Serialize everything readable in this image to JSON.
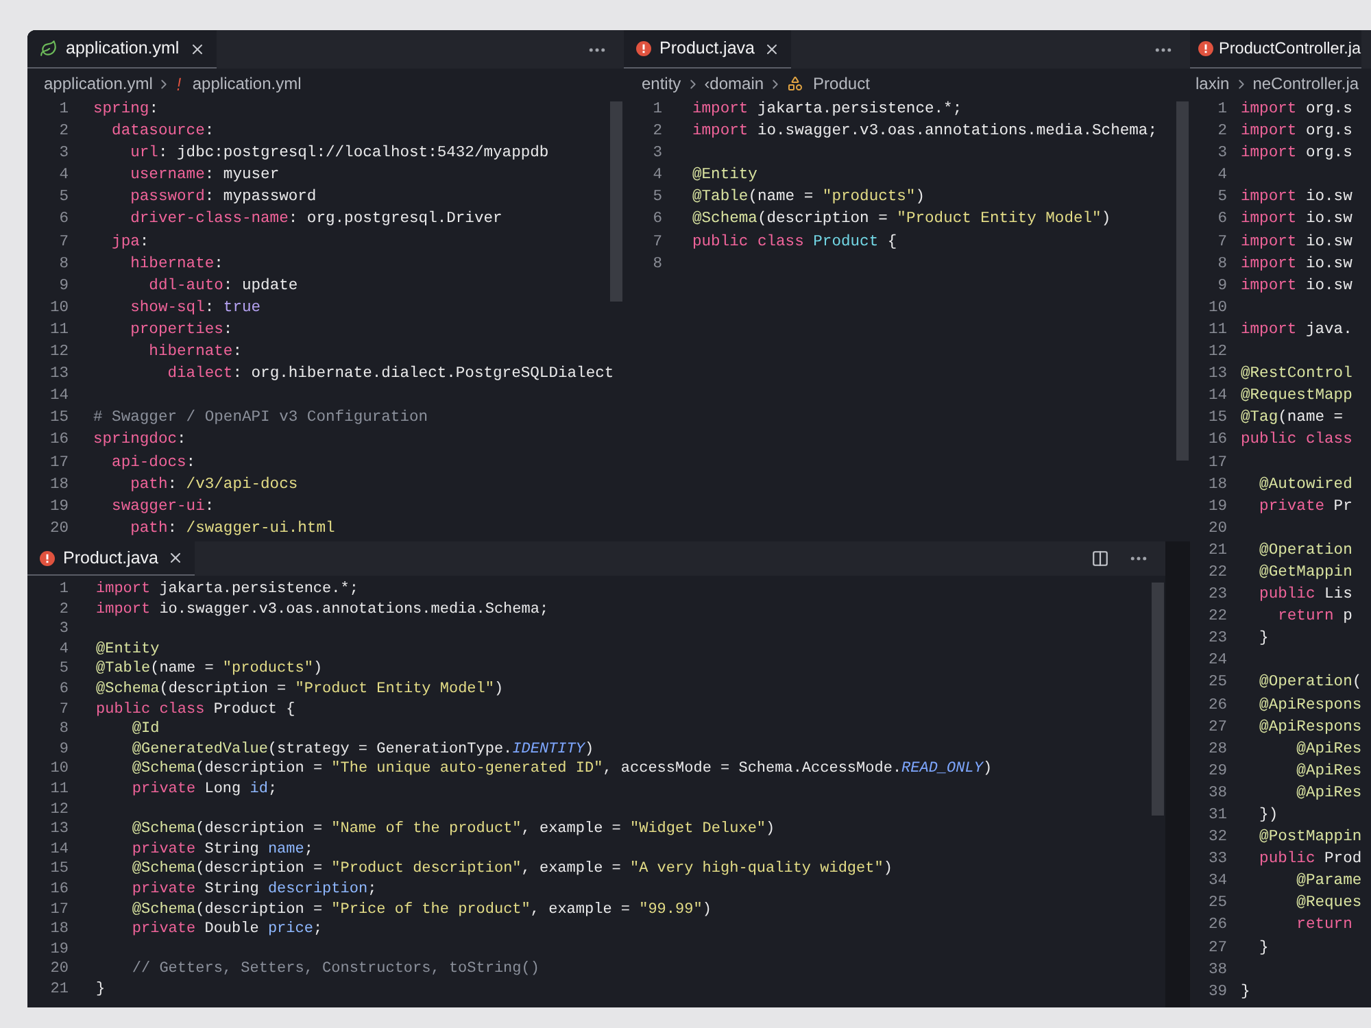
{
  "main": {
    "top_editors": [
      {
        "tab": {
          "label": "application.yml",
          "kind": "yaml",
          "selected": true
        },
        "breadcrumb": [
          {
            "label": "application.yml",
            "kind": "path"
          },
          {
            "label": "application.yml",
            "kind": "file"
          }
        ],
        "actions": [
          {
            "kind": "more"
          }
        ],
        "lines": [
          {
            "number": "1",
            "tokens": [
              {
                "kind": "key",
                "text": "spring"
              },
              {
                "kind": "plain",
                "text": ":"
              }
            ]
          },
          {
            "number": "2",
            "tokens": [
              {
                "kind": "key",
                "text": "  datasource"
              },
              {
                "kind": "plain",
                "text": ":"
              }
            ]
          },
          {
            "number": "3",
            "tokens": [
              {
                "kind": "key",
                "text": "    url"
              },
              {
                "kind": "plain",
                "text": ": jdbc:postgresql://localhost:5432/myappdb"
              }
            ]
          },
          {
            "number": "4",
            "tokens": [
              {
                "kind": "key",
                "text": "    username"
              },
              {
                "kind": "plain",
                "text": ": myuser"
              }
            ]
          },
          {
            "number": "5",
            "tokens": [
              {
                "kind": "key",
                "text": "    password"
              },
              {
                "kind": "plain",
                "text": ": mypassword"
              }
            ]
          },
          {
            "number": "6",
            "tokens": [
              {
                "kind": "key",
                "text": "    driver-class-name"
              },
              {
                "kind": "plain",
                "text": ": org.postgresql.Driver"
              }
            ]
          },
          {
            "number": "7",
            "tokens": [
              {
                "kind": "key",
                "text": "  jpa"
              },
              {
                "kind": "plain",
                "text": ":"
              }
            ]
          },
          {
            "number": "8",
            "tokens": [
              {
                "kind": "key",
                "text": "    hibernate"
              },
              {
                "kind": "plain",
                "text": ":"
              }
            ]
          },
          {
            "number": "9",
            "tokens": [
              {
                "kind": "key",
                "text": "      ddl-auto"
              },
              {
                "kind": "plain",
                "text": ": update"
              }
            ]
          },
          {
            "number": "10",
            "tokens": [
              {
                "kind": "key",
                "text": "    show-sql"
              },
              {
                "kind": "plain",
                "text": ": "
              },
              {
                "kind": "bool",
                "text": "true"
              }
            ]
          },
          {
            "number": "11",
            "tokens": [
              {
                "kind": "key",
                "text": "    properties"
              },
              {
                "kind": "plain",
                "text": ":"
              }
            ]
          },
          {
            "number": "12",
            "tokens": [
              {
                "kind": "key",
                "text": "      hibernate"
              },
              {
                "kind": "plain",
                "text": ":"
              }
            ]
          },
          {
            "number": "13",
            "tokens": [
              {
                "kind": "key",
                "text": "        dialect"
              },
              {
                "kind": "plain",
                "text": ": org.hibernate.dialect.PostgreSQLDialect"
              }
            ]
          },
          {
            "number": "14"
          },
          {
            "number": "15",
            "tokens": [
              {
                "kind": "comment",
                "text": "# Swagger / OpenAPI v3 Configuration"
              }
            ]
          },
          {
            "number": "16",
            "tokens": [
              {
                "kind": "key",
                "text": "springdoc"
              },
              {
                "kind": "plain",
                "text": ":"
              }
            ]
          },
          {
            "number": "17",
            "tokens": [
              {
                "kind": "key",
                "text": "  api-docs"
              },
              {
                "kind": "plain",
                "text": ":"
              }
            ]
          },
          {
            "number": "18",
            "tokens": [
              {
                "kind": "key",
                "text": "    path"
              },
              {
                "kind": "plain",
                "text": ": "
              },
              {
                "kind": "str",
                "text": "/v3/api-docs"
              }
            ]
          },
          {
            "number": "19",
            "tokens": [
              {
                "kind": "key",
                "text": "  swagger-ui"
              },
              {
                "kind": "plain",
                "text": ":"
              }
            ]
          },
          {
            "number": "20",
            "tokens": [
              {
                "kind": "key",
                "text": "    path"
              },
              {
                "kind": "plain",
                "text": ": "
              },
              {
                "kind": "str",
                "text": "/swagger-ui.html"
              }
            ]
          }
        ]
      },
      {
        "tab": {
          "label": "Product.java",
          "kind": "java",
          "selected": true
        },
        "breadcrumb": [
          {
            "label": "entity",
            "kind": "path"
          },
          {
            "label": "‹domain",
            "kind": "path"
          },
          {
            "label": "Product",
            "kind": "symbol"
          }
        ],
        "actions": [
          {
            "kind": "more"
          }
        ],
        "lines": [
          {
            "number": "1",
            "tokens": [
              {
                "kind": "kw",
                "text": "import"
              },
              {
                "kind": "plain",
                "text": " jakarta.persistence.*;"
              }
            ]
          },
          {
            "number": "2",
            "tokens": [
              {
                "kind": "kw",
                "text": "import"
              },
              {
                "kind": "plain",
                "text": " io.swagger.v3.oas.annotations.media.Schema;"
              }
            ]
          },
          {
            "number": "3"
          },
          {
            "number": "4",
            "tokens": [
              {
                "kind": "ann",
                "text": "@Entity"
              }
            ]
          },
          {
            "number": "5",
            "tokens": [
              {
                "kind": "ann",
                "text": "@Table"
              },
              {
                "kind": "plain",
                "text": "(name = "
              },
              {
                "kind": "str",
                "text": "\"products\""
              },
              {
                "kind": "plain",
                "text": ")"
              }
            ]
          },
          {
            "number": "6",
            "tokens": [
              {
                "kind": "ann",
                "text": "@Schema"
              },
              {
                "kind": "plain",
                "text": "(description = "
              },
              {
                "kind": "str",
                "text": "\"Product Entity Model\""
              },
              {
                "kind": "plain",
                "text": ")"
              }
            ]
          },
          {
            "number": "7",
            "tokens": [
              {
                "kind": "kw",
                "text": "public class "
              },
              {
                "kind": "type",
                "text": "Product"
              },
              {
                "kind": "plain",
                "text": " {"
              }
            ]
          },
          {
            "number": "8"
          }
        ]
      }
    ],
    "bottom_editor": {
      "tab": {
        "label": "Product.java",
        "kind": "java",
        "selected": true
      },
      "actions": [
        {
          "kind": "split"
        },
        {
          "kind": "more"
        }
      ],
      "lines": [
        {
          "number": "1",
          "tokens": [
            {
              "kind": "kw",
              "text": "import"
            },
            {
              "kind": "plain",
              "text": " jakarta.persistence.*;"
            }
          ]
        },
        {
          "number": "2",
          "tokens": [
            {
              "kind": "kw",
              "text": "import"
            },
            {
              "kind": "plain",
              "text": " io.swagger.v3.oas.annotations.media.Schema;"
            }
          ]
        },
        {
          "number": "3"
        },
        {
          "number": "4",
          "tokens": [
            {
              "kind": "ann",
              "text": "@Entity"
            }
          ]
        },
        {
          "number": "5",
          "tokens": [
            {
              "kind": "ann",
              "text": "@Table"
            },
            {
              "kind": "plain",
              "text": "(name = "
            },
            {
              "kind": "str",
              "text": "\"products\""
            },
            {
              "kind": "plain",
              "text": ")"
            }
          ]
        },
        {
          "number": "6",
          "tokens": [
            {
              "kind": "ann",
              "text": "@Schema"
            },
            {
              "kind": "plain",
              "text": "(description = "
            },
            {
              "kind": "str",
              "text": "\"Product Entity Model\""
            },
            {
              "kind": "plain",
              "text": ")"
            }
          ]
        },
        {
          "number": "7",
          "tokens": [
            {
              "kind": "kw",
              "text": "public class"
            },
            {
              "kind": "plain",
              "text": " Product {"
            }
          ]
        },
        {
          "number": "8",
          "tokens": [
            {
              "kind": "ann",
              "text": "    @Id"
            }
          ]
        },
        {
          "number": "9",
          "tokens": [
            {
              "kind": "ann",
              "text": "    @GeneratedValue"
            },
            {
              "kind": "plain",
              "text": "(strategy = GenerationType."
            },
            {
              "kind": "const",
              "text": "IDENTITY"
            },
            {
              "kind": "plain",
              "text": ")"
            }
          ]
        },
        {
          "number": "10",
          "tokens": [
            {
              "kind": "ann",
              "text": "    @Schema"
            },
            {
              "kind": "plain",
              "text": "(description = "
            },
            {
              "kind": "str",
              "text": "\"The unique auto-generated ID\""
            },
            {
              "kind": "plain",
              "text": ", accessMode = Schema.AccessMode."
            },
            {
              "kind": "const",
              "text": "READ_ONLY"
            },
            {
              "kind": "plain",
              "text": ")"
            }
          ]
        },
        {
          "number": "11",
          "tokens": [
            {
              "kind": "kw",
              "text": "    private"
            },
            {
              "kind": "plain",
              "text": " Long "
            },
            {
              "kind": "field",
              "text": "id"
            },
            {
              "kind": "plain",
              "text": ";"
            }
          ]
        },
        {
          "number": "12"
        },
        {
          "number": "13",
          "tokens": [
            {
              "kind": "ann",
              "text": "    @Schema"
            },
            {
              "kind": "plain",
              "text": "(description = "
            },
            {
              "kind": "str",
              "text": "\"Name of the product\""
            },
            {
              "kind": "plain",
              "text": ", example = "
            },
            {
              "kind": "str",
              "text": "\"Widget Deluxe\""
            },
            {
              "kind": "plain",
              "text": ")"
            }
          ]
        },
        {
          "number": "14",
          "tokens": [
            {
              "kind": "kw",
              "text": "    private"
            },
            {
              "kind": "plain",
              "text": " String "
            },
            {
              "kind": "field",
              "text": "name"
            },
            {
              "kind": "plain",
              "text": ";"
            }
          ]
        },
        {
          "number": "15",
          "tokens": [
            {
              "kind": "ann",
              "text": "    @Schema"
            },
            {
              "kind": "plain",
              "text": "(description = "
            },
            {
              "kind": "str",
              "text": "\"Product description\""
            },
            {
              "kind": "plain",
              "text": ", example = "
            },
            {
              "kind": "str",
              "text": "\"A very high-quality widget\""
            },
            {
              "kind": "plain",
              "text": ")"
            }
          ]
        },
        {
          "number": "16",
          "tokens": [
            {
              "kind": "kw",
              "text": "    private"
            },
            {
              "kind": "plain",
              "text": " String "
            },
            {
              "kind": "field",
              "text": "description"
            },
            {
              "kind": "plain",
              "text": ";"
            }
          ]
        },
        {
          "number": "17",
          "tokens": [
            {
              "kind": "ann",
              "text": "    @Schema"
            },
            {
              "kind": "plain",
              "text": "(description = "
            },
            {
              "kind": "str",
              "text": "\"Price of the product\""
            },
            {
              "kind": "plain",
              "text": ", example = "
            },
            {
              "kind": "str",
              "text": "\"99.99\""
            },
            {
              "kind": "plain",
              "text": ")"
            }
          ]
        },
        {
          "number": "18",
          "tokens": [
            {
              "kind": "kw",
              "text": "    private"
            },
            {
              "kind": "plain",
              "text": " Double "
            },
            {
              "kind": "field",
              "text": "price"
            },
            {
              "kind": "plain",
              "text": ";"
            }
          ]
        },
        {
          "number": "19"
        },
        {
          "number": "20",
          "tokens": [
            {
              "kind": "comment",
              "text": "    // Getters, Setters, Constructors, toString()"
            }
          ]
        },
        {
          "number": "21",
          "tokens": [
            {
              "kind": "plain",
              "text": "}"
            }
          ]
        }
      ]
    }
  },
  "side_editor": {
    "tab": {
      "label": "ProductController.ja",
      "kind": "java",
      "selected": true
    },
    "breadcrumb": [
      {
        "label": "laxin",
        "kind": "path"
      },
      {
        "label": "neController.ja",
        "kind": "path"
      }
    ],
    "lines": [
      {
        "number": "1",
        "tokens": [
          {
            "kind": "kw",
            "text": "import"
          },
          {
            "kind": "plain",
            "text": " org.s"
          }
        ]
      },
      {
        "number": "2",
        "tokens": [
          {
            "kind": "kw",
            "text": "import"
          },
          {
            "kind": "plain",
            "text": " org.s"
          }
        ]
      },
      {
        "number": "3",
        "tokens": [
          {
            "kind": "kw",
            "text": "import"
          },
          {
            "kind": "plain",
            "text": " org.s"
          }
        ]
      },
      {
        "number": "4"
      },
      {
        "number": "5",
        "tokens": [
          {
            "kind": "kw",
            "text": "import"
          },
          {
            "kind": "plain",
            "text": " io.sw"
          }
        ]
      },
      {
        "number": "6",
        "tokens": [
          {
            "kind": "kw",
            "text": "import"
          },
          {
            "kind": "plain",
            "text": " io.sw"
          }
        ]
      },
      {
        "number": "7",
        "tokens": [
          {
            "kind": "kw",
            "text": "import"
          },
          {
            "kind": "plain",
            "text": " io.sw"
          }
        ]
      },
      {
        "number": "8",
        "tokens": [
          {
            "kind": "kw",
            "text": "import"
          },
          {
            "kind": "plain",
            "text": " io.sw"
          }
        ]
      },
      {
        "number": "9",
        "tokens": [
          {
            "kind": "kw",
            "text": "import"
          },
          {
            "kind": "plain",
            "text": " io.sw"
          }
        ]
      },
      {
        "number": "10"
      },
      {
        "number": "11",
        "tokens": [
          {
            "kind": "kw",
            "text": "import"
          },
          {
            "kind": "plain",
            "text": " java."
          }
        ]
      },
      {
        "number": "12"
      },
      {
        "number": "13",
        "tokens": [
          {
            "kind": "ann",
            "text": "@RestControl"
          }
        ]
      },
      {
        "number": "14",
        "tokens": [
          {
            "kind": "ann",
            "text": "@RequestMapp"
          }
        ]
      },
      {
        "number": "15",
        "tokens": [
          {
            "kind": "ann",
            "text": "@Tag"
          },
          {
            "kind": "plain",
            "text": "(name ="
          }
        ]
      },
      {
        "number": "16",
        "tokens": [
          {
            "kind": "kw",
            "text": "public class"
          }
        ]
      },
      {
        "number": "17"
      },
      {
        "number": "18",
        "tokens": [
          {
            "kind": "ann",
            "text": "  @Autowired"
          }
        ]
      },
      {
        "number": "19",
        "tokens": [
          {
            "kind": "kw",
            "text": "  private"
          },
          {
            "kind": "plain",
            "text": " Pr"
          }
        ]
      },
      {
        "number": "20"
      },
      {
        "number": "21",
        "tokens": [
          {
            "kind": "ann",
            "text": "  @Operation"
          }
        ]
      },
      {
        "number": "22",
        "tokens": [
          {
            "kind": "ann",
            "text": "  @GetMappin"
          }
        ]
      },
      {
        "number": "23",
        "tokens": [
          {
            "kind": "kw",
            "text": "  public"
          },
          {
            "kind": "plain",
            "text": " Lis"
          }
        ]
      },
      {
        "number": "22",
        "tokens": [
          {
            "kind": "kw",
            "text": "    return"
          },
          {
            "kind": "plain",
            "text": " p"
          }
        ]
      },
      {
        "number": "23",
        "tokens": [
          {
            "kind": "plain",
            "text": "  }"
          }
        ]
      },
      {
        "number": "24"
      },
      {
        "number": "25",
        "tokens": [
          {
            "kind": "ann",
            "text": "  @Operation"
          },
          {
            "kind": "plain",
            "text": "("
          }
        ]
      },
      {
        "number": "26",
        "tokens": [
          {
            "kind": "ann",
            "text": "  @ApiRespons"
          }
        ]
      },
      {
        "number": "27",
        "tokens": [
          {
            "kind": "ann",
            "text": "  @ApiRespons"
          }
        ]
      },
      {
        "number": "28",
        "tokens": [
          {
            "kind": "ann",
            "text": "      @ApiRes"
          }
        ]
      },
      {
        "number": "29",
        "tokens": [
          {
            "kind": "ann",
            "text": "      @ApiRes"
          }
        ]
      },
      {
        "number": "38",
        "tokens": [
          {
            "kind": "ann",
            "text": "      @ApiRes"
          }
        ]
      },
      {
        "number": "31",
        "tokens": [
          {
            "kind": "plain",
            "text": "  })"
          }
        ]
      },
      {
        "number": "32",
        "tokens": [
          {
            "kind": "ann",
            "text": "  @PostMappin"
          }
        ]
      },
      {
        "number": "33",
        "tokens": [
          {
            "kind": "kw",
            "text": "  public"
          },
          {
            "kind": "plain",
            "text": " Prod"
          }
        ]
      },
      {
        "number": "34",
        "tokens": [
          {
            "kind": "ann",
            "text": "      @Parame"
          }
        ]
      },
      {
        "number": "25",
        "tokens": [
          {
            "kind": "ann",
            "text": "      @Reques"
          }
        ]
      },
      {
        "number": "26",
        "tokens": [
          {
            "kind": "kw",
            "text": "      return"
          }
        ]
      },
      {
        "number": "27",
        "tokens": [
          {
            "kind": "plain",
            "text": "  }"
          }
        ]
      },
      {
        "number": "38"
      },
      {
        "number": "39",
        "tokens": [
          {
            "kind": "plain",
            "text": "}"
          }
        ]
      }
    ]
  }
}
